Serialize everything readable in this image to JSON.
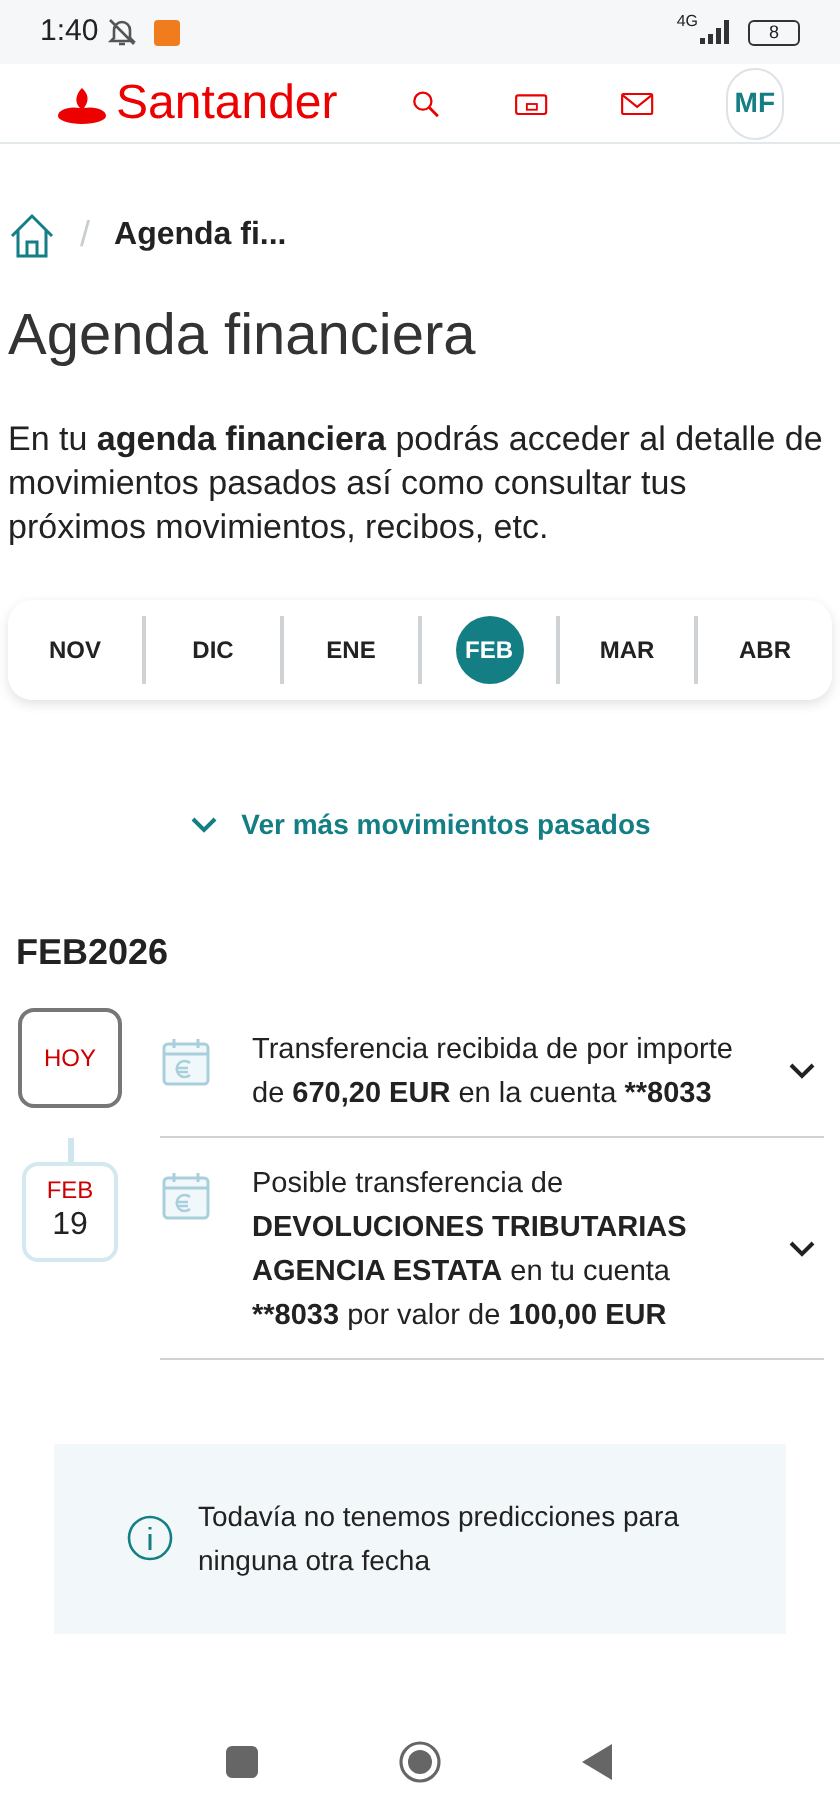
{
  "status_bar": {
    "time": "1:40",
    "network": "4G",
    "battery": "8"
  },
  "header": {
    "logo": "Santander",
    "avatar": "MF"
  },
  "breadcrumb": {
    "separator": "/",
    "current": "Agenda fi..."
  },
  "title": "Agenda financiera",
  "intro": "En tu **agenda financiera** podrás acceder al detalle de movimientos pasados así como consultar tus próximos movimientos, recibos, etc.",
  "months": [
    {
      "label": "NOV",
      "selected": false
    },
    {
      "label": "DIC",
      "selected": false
    },
    {
      "label": "ENE",
      "selected": false
    },
    {
      "label": "FEB",
      "selected": true
    },
    {
      "label": "MAR",
      "selected": false
    },
    {
      "label": "ABR",
      "selected": false
    }
  ],
  "more_link": "Ver más movimientos pasados",
  "period": "FEB2026",
  "events": [
    {
      "kind": "today",
      "date_label": "HOY",
      "text": "Transferencia recibida de por importe de **670,20 EUR** en la cuenta ****8033**"
    },
    {
      "kind": "date",
      "date_label": "FEB",
      "day": "19",
      "text": "Posible transferencia de **DEVOLUCIONES TRIBUTARIAS AGENCIA ESTATA** en tu cuenta ****8033** por valor de **100,00 EUR**"
    }
  ],
  "info": "Todavía no tenemos predicciones para ninguna otra fecha"
}
